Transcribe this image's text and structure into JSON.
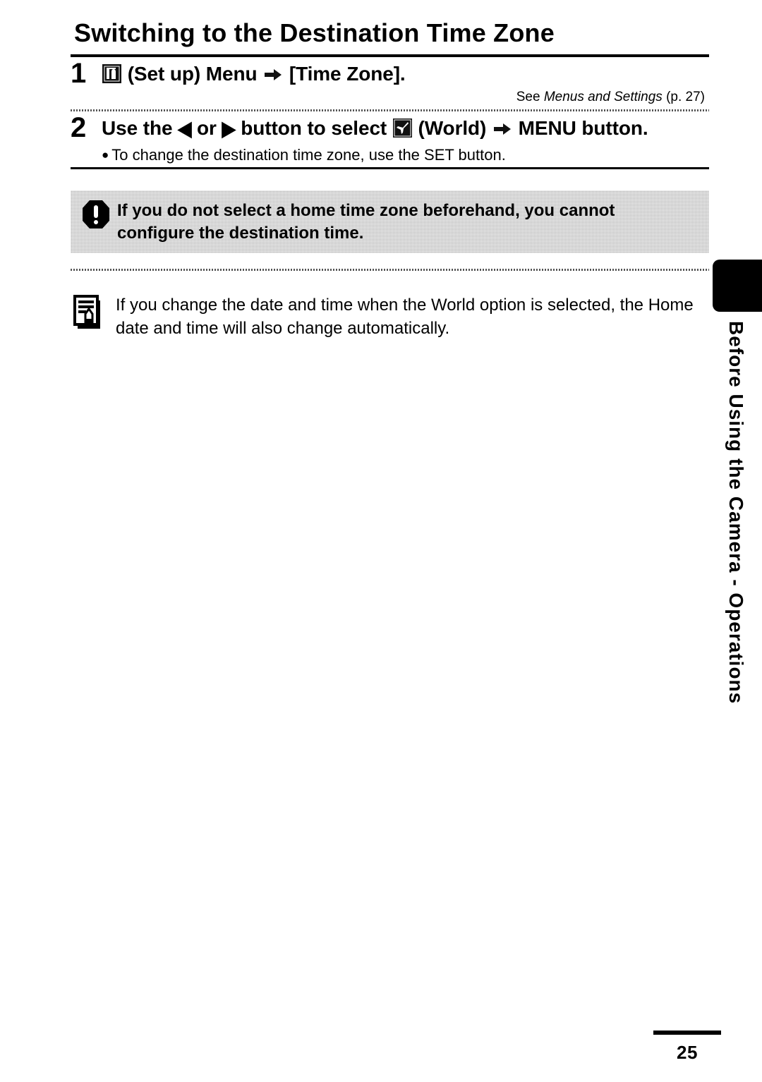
{
  "page": {
    "title": "Switching to the Destination Time Zone",
    "number": "25",
    "section_tab": "Before Using the Camera - Operations"
  },
  "steps": [
    {
      "number": "1",
      "icon": "setup-menu-icon",
      "text_before_icon": "",
      "text_after_icon": "(Set up) Menu",
      "arrow": "arrow-right-icon",
      "text_end": "[Time Zone].",
      "reference_prefix": "See ",
      "reference_italic": "Menus and Settings",
      "reference_suffix": " (p. 27)"
    },
    {
      "number": "2",
      "part1": "Use the",
      "left_triangle": "◀",
      "or_text": "or",
      "right_triangle": "▶",
      "part2": "button to select",
      "icon": "world-airplane-icon",
      "part3": "(World)",
      "arrow": "arrow-right-icon",
      "part4": "MENU",
      "part5": "button.",
      "bullet": "To change the destination time zone, use the SET button."
    }
  ],
  "warning": {
    "icon": "exclamation-warning-icon",
    "text": "If you do not select a home time zone beforehand, you cannot configure the destination time."
  },
  "note": {
    "icon": "note-memo-icon",
    "text": "If you change the date and time when the World option is selected, the Home date and time will also change automatically."
  },
  "colors": {
    "text": "#000000",
    "background": "#ffffff",
    "warning_background": "#b9b9b9",
    "tab": "#000000"
  }
}
